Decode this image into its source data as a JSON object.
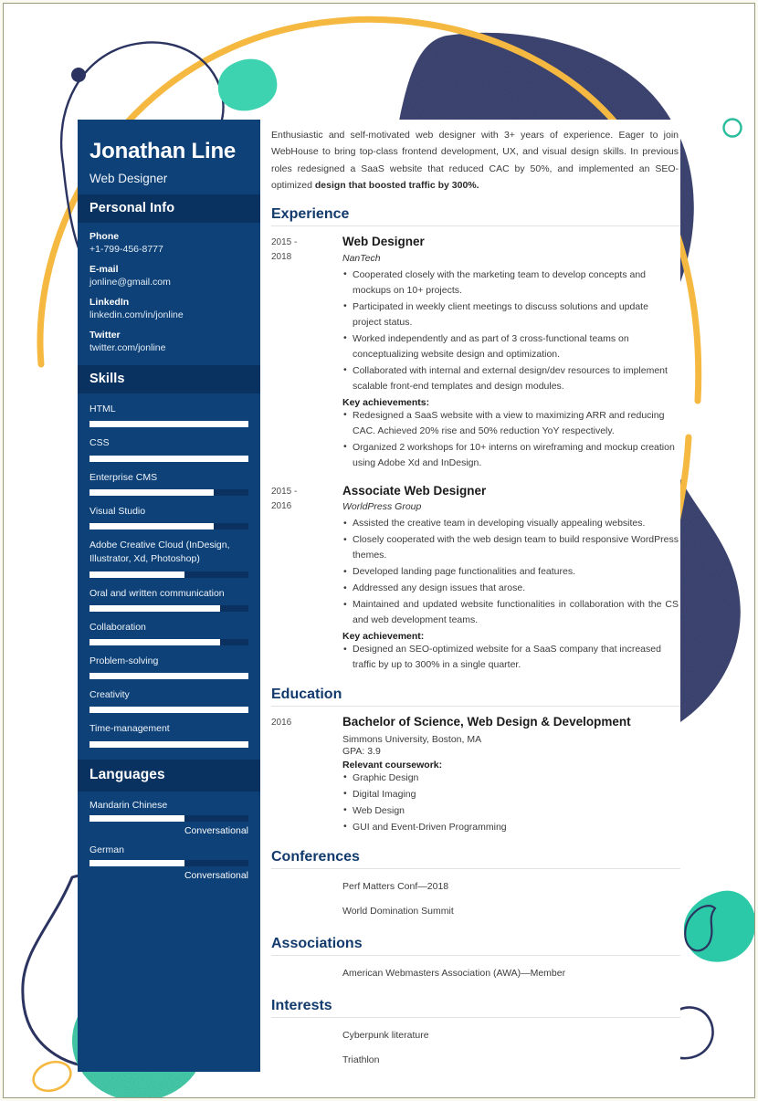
{
  "sidebar": {
    "name": "Jonathan Line",
    "job_title": "Web Designer",
    "personal_info_heading": "Personal Info",
    "contacts": [
      {
        "label": "Phone",
        "value": "+1-799-456-8777"
      },
      {
        "label": "E-mail",
        "value": "jonline@gmail.com"
      },
      {
        "label": "LinkedIn",
        "value": "linkedin.com/in/jonline"
      },
      {
        "label": "Twitter",
        "value": "twitter.com/jonline"
      }
    ],
    "skills_heading": "Skills",
    "skills": [
      {
        "name": "HTML",
        "level": 100
      },
      {
        "name": "CSS",
        "level": 100
      },
      {
        "name": "Enterprise CMS",
        "level": 78
      },
      {
        "name": "Visual Studio",
        "level": 78
      },
      {
        "name": "Adobe Creative Cloud (InDesign, Illustrator, Xd, Photoshop)",
        "level": 60
      },
      {
        "name": "Oral and written communication",
        "level": 82
      },
      {
        "name": "Collaboration",
        "level": 82
      },
      {
        "name": "Problem-solving",
        "level": 100
      },
      {
        "name": "Creativity",
        "level": 100
      },
      {
        "name": "Time-management",
        "level": 100
      }
    ],
    "languages_heading": "Languages",
    "languages": [
      {
        "name": "Mandarin Chinese",
        "level": 60,
        "proficiency": "Conversational"
      },
      {
        "name": "German",
        "level": 60,
        "proficiency": "Conversational"
      }
    ]
  },
  "main": {
    "summary": "Enthusiastic and self-motivated web designer with 3+ years of experience. Eager to join WebHouse to bring top-class frontend development, UX, and visual design skills. In previous roles redesigned a SaaS website that reduced CAC by 50%, and implemented an SEO-optimized design that boosted traffic by 300%.",
    "experience_heading": "Experience",
    "experience": [
      {
        "date": "2015 - 2018",
        "role": "Web Designer",
        "org": "NanTech",
        "bullets": [
          "Cooperated closely with the marketing team to develop concepts and mockups on 10+ projects.",
          "Participated in weekly client meetings to discuss solutions and update project status.",
          "Worked independently and as part of 3 cross-functional teams on conceptualizing website design and optimization.",
          "Collaborated with internal and external design/dev resources to implement scalable front-end templates and design modules."
        ],
        "achievements_label": "Key achievements:",
        "achievements": [
          "Redesigned a SaaS website with a view to maximizing ARR and reducing CAC. Achieved 20% rise and 50% reduction YoY respectively.",
          "Organized 2 workshops for 10+ interns on wireframing and mockup creation using Adobe Xd and InDesign."
        ]
      },
      {
        "date": "2015 - 2016",
        "role": "Associate Web Designer",
        "org": "WorldPress Group",
        "bullets": [
          "Assisted the creative team in developing visually appealing websites.",
          "Closely cooperated with the web design team to build responsive WordPress themes.",
          "Developed landing page functionalities and features.",
          "Addressed any design issues that arose.",
          "Maintained and updated website functionalities in collaboration with the CS and web development teams."
        ],
        "achievements_label": "Key achievement:",
        "achievements": [
          "Designed an SEO-optimized website for a SaaS company that increased traffic by up to 300% in a single quarter."
        ]
      }
    ],
    "education_heading": "Education",
    "education": {
      "date": "2016",
      "degree": "Bachelor of Science, Web Design & Development",
      "school": "Simmons University, Boston, MA",
      "gpa": "GPA: 3.9",
      "coursework_label": "Relevant coursework:",
      "coursework": [
        "Graphic Design",
        "Digital Imaging",
        "Web Design",
        "GUI and Event-Driven Programming"
      ]
    },
    "conferences_heading": "Conferences",
    "conferences": [
      "Perf Matters Conf—2018",
      "World Domination Summit"
    ],
    "associations_heading": "Associations",
    "associations": [
      "American Webmasters Association (AWA)—Member"
    ],
    "interests_heading": "Interests",
    "interests": [
      "Cyberpunk literature",
      "Triathlon"
    ]
  },
  "colors": {
    "sidebar_navy": "#0d4178",
    "sidebar_heading_navy": "#0a3260",
    "section_heading_navy": "#123a6d",
    "decor_navy": "#2b3360",
    "decor_teal": "#3ed3b0",
    "decor_yellow": "#f5b942"
  }
}
